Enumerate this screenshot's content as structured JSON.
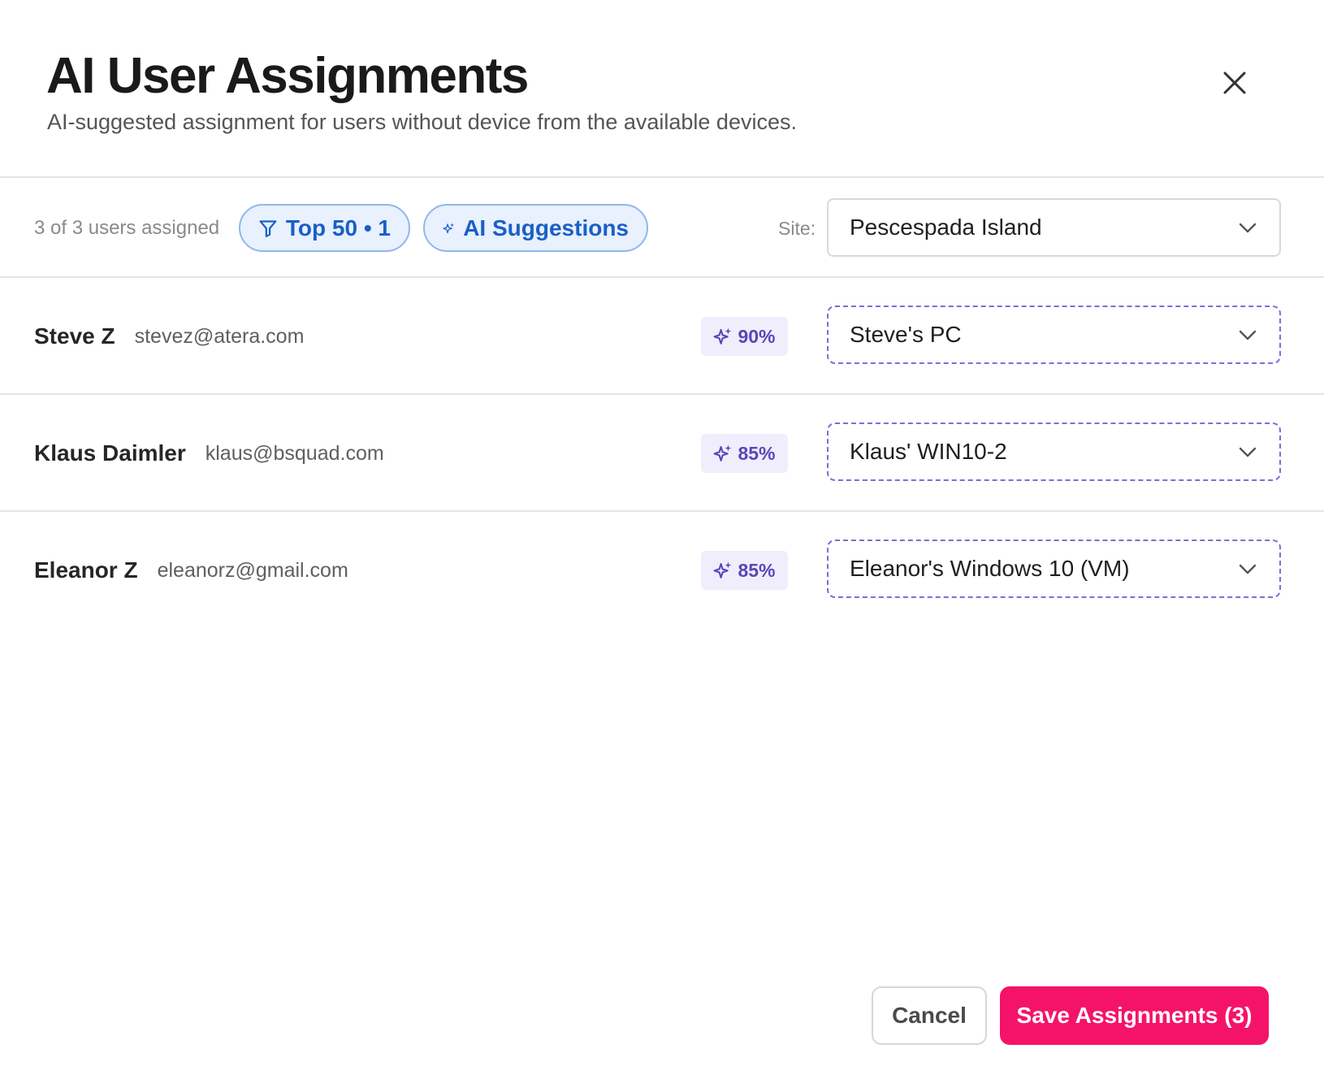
{
  "header": {
    "title": "AI User Assignments",
    "subtitle": "AI-suggested assignment for users without device from the available devices."
  },
  "toolbar": {
    "assigned_text": "3 of 3 users assigned",
    "filter_label": "Top 50 • 1",
    "ai_label": "AI Suggestions",
    "site_label": "Site:",
    "site_value": "Pescespada Island"
  },
  "rows": [
    {
      "name": "Steve Z",
      "email": "stevez@atera.com",
      "score": "90%",
      "device": "Steve's PC"
    },
    {
      "name": "Klaus Daimler",
      "email": "klaus@bsquad.com",
      "score": "85%",
      "device": "Klaus' WIN10-2"
    },
    {
      "name": "Eleanor Z",
      "email": "eleanorz@gmail.com",
      "score": "85%",
      "device": "Eleanor's Windows 10 (VM)"
    }
  ],
  "footer": {
    "cancel_label": "Cancel",
    "save_label": "Save Assignments (3)"
  },
  "icons": {
    "close": "close-icon",
    "filter": "filter-icon",
    "ai": "sparkle-icon",
    "chevron": "chevron-down-icon"
  },
  "colors": {
    "pill_text": "#1a5fc7",
    "pill_bg": "#e8f1fd",
    "score_text": "#5a46b8",
    "score_bg": "#f0eefc",
    "dashed_border": "#7b6fd9",
    "save_bg": "#f5136a"
  }
}
